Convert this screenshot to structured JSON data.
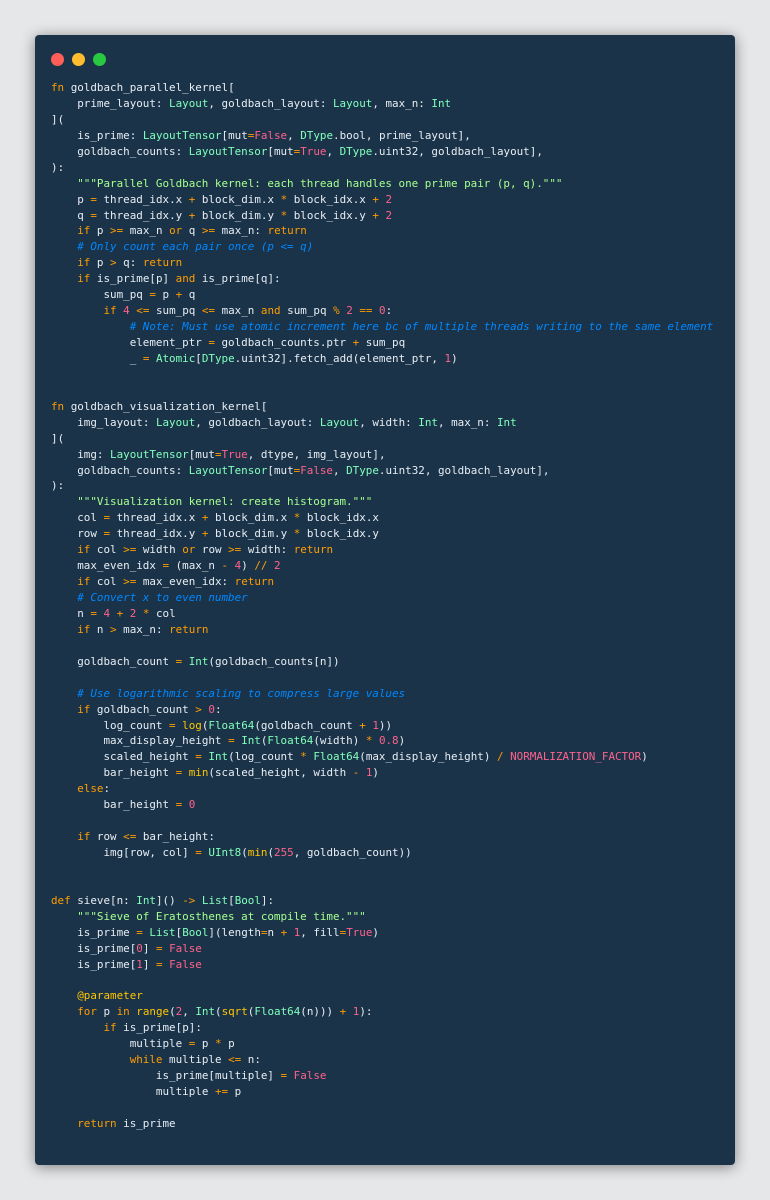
{
  "window": {
    "controls": [
      "close",
      "minimize",
      "maximize"
    ],
    "colors": {
      "background": "#1b3349",
      "close": "#ff5f57",
      "minimize": "#febc2e",
      "maximize": "#28c840"
    }
  },
  "code": {
    "language": "mojo",
    "lines": [
      "fn goldbach_parallel_kernel[",
      "    prime_layout: Layout, goldbach_layout: Layout, max_n: Int",
      "](",
      "    is_prime: LayoutTensor[mut=False, DType.bool, prime_layout],",
      "    goldbach_counts: LayoutTensor[mut=True, DType.uint32, goldbach_layout],",
      "):",
      "    \"\"\"Parallel Goldbach kernel: each thread handles one prime pair (p, q).\"\"\"",
      "    p = thread_idx.x + block_dim.x * block_idx.x + 2",
      "    q = thread_idx.y + block_dim.y * block_idx.y + 2",
      "    if p >= max_n or q >= max_n: return",
      "    # Only count each pair once (p <= q)",
      "    if p > q: return",
      "    if is_prime[p] and is_prime[q]:",
      "        sum_pq = p + q",
      "        if 4 <= sum_pq <= max_n and sum_pq % 2 == 0:",
      "            # Note: Must use atomic increment here bc of multiple threads writing to the same element",
      "            element_ptr = goldbach_counts.ptr + sum_pq",
      "            _ = Atomic[DType.uint32].fetch_add(element_ptr, 1)",
      "",
      "",
      "fn goldbach_visualization_kernel[",
      "    img_layout: Layout, goldbach_layout: Layout, width: Int, max_n: Int",
      "](",
      "    img: LayoutTensor[mut=True, dtype, img_layout],",
      "    goldbach_counts: LayoutTensor[mut=False, DType.uint32, goldbach_layout],",
      "):",
      "    \"\"\"Visualization kernel: create histogram.\"\"\"",
      "    col = thread_idx.x + block_dim.x * block_idx.x",
      "    row = thread_idx.y + block_dim.y * block_idx.y",
      "    if col >= width or row >= width: return",
      "    max_even_idx = (max_n - 4) // 2",
      "    if col >= max_even_idx: return",
      "    # Convert x to even number",
      "    n = 4 + 2 * col",
      "    if n > max_n: return",
      "",
      "    goldbach_count = Int(goldbach_counts[n])",
      "",
      "    # Use logarithmic scaling to compress large values",
      "    if goldbach_count > 0:",
      "        log_count = log(Float64(goldbach_count + 1))",
      "        max_display_height = Int(Float64(width) * 0.8)",
      "        scaled_height = Int(log_count * Float64(max_display_height) / NORMALIZATION_FACTOR)",
      "        bar_height = min(scaled_height, width - 1)",
      "    else:",
      "        bar_height = 0",
      "",
      "    if row <= bar_height:",
      "        img[row, col] = UInt8(min(255, goldbach_count))",
      "",
      "",
      "def sieve[n: Int]() -> List[Bool]:",
      "    \"\"\"Sieve of Eratosthenes at compile time.\"\"\"",
      "    is_prime = List[Bool](length=n + 1, fill=True)",
      "    is_prime[0] = False",
      "    is_prime[1] = False",
      "",
      "    @parameter",
      "    for p in range(2, Int(sqrt(Float64(n))) + 1):",
      "        if is_prime[p]:",
      "            multiple = p * p",
      "            while multiple <= n:",
      "                is_prime[multiple] = False",
      "                multiple += p",
      "",
      "    return is_prime"
    ]
  }
}
